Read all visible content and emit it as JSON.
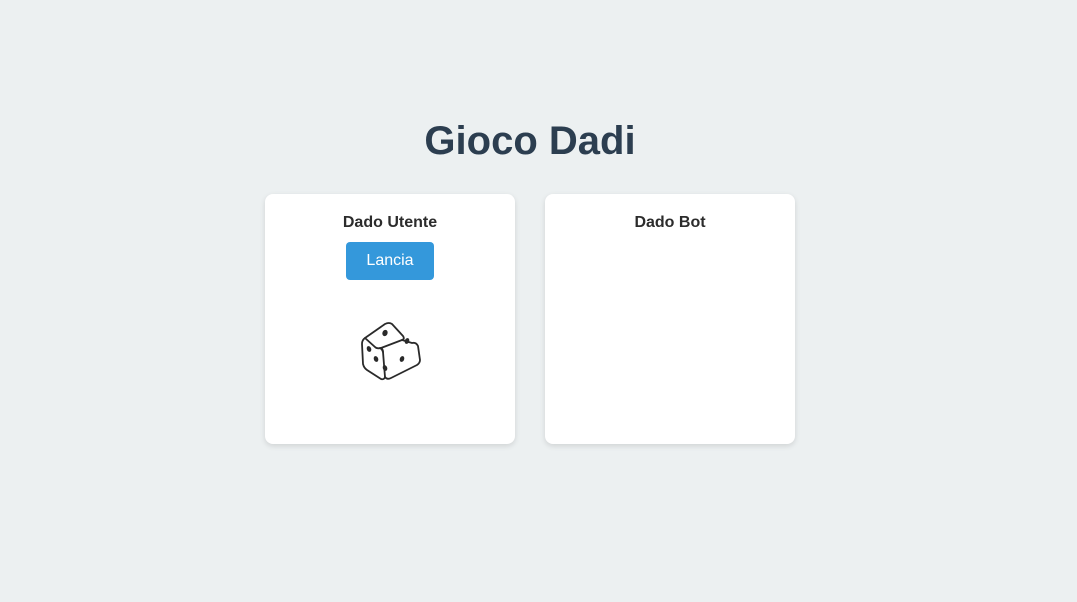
{
  "title": "Gioco Dadi",
  "user_panel": {
    "heading": "Dado Utente",
    "roll_button_label": "Lancia",
    "dice_icon": "dice-icon"
  },
  "bot_panel": {
    "heading": "Dado Bot"
  },
  "colors": {
    "background": "#ecf0f1",
    "title": "#2c3e50",
    "button": "#3498db",
    "card": "#ffffff"
  }
}
